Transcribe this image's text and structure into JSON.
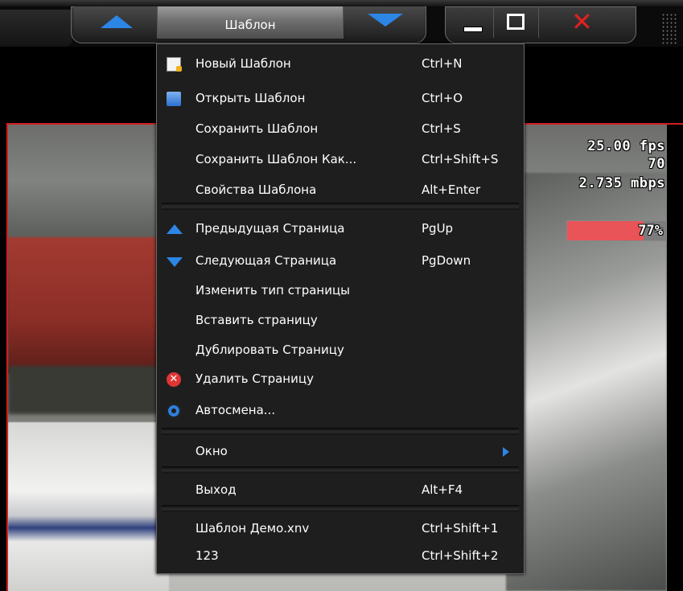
{
  "toolbar": {
    "template_label": "Шаблон",
    "prev_icon": "triangle-up-icon",
    "next_icon": "triangle-down-icon",
    "close_glyph": "✕"
  },
  "stats": {
    "fps": "25.00 fps",
    "count": "70",
    "bitrate": "2.735 mbps",
    "progress_label": "77%",
    "progress_value": 0.77
  },
  "menu": {
    "items": [
      {
        "label": "Новый Шаблон",
        "shortcut": "Ctrl+N",
        "icon": "new-document-icon"
      },
      {
        "label": "Открыть Шаблон",
        "shortcut": "Ctrl+O",
        "icon": "open-folder-icon"
      },
      {
        "label": "Сохранить Шаблон",
        "shortcut": "Ctrl+S"
      },
      {
        "label": "Сохранить Шаблон Как...",
        "shortcut": "Ctrl+Shift+S"
      },
      {
        "label": "Свойства Шаблона",
        "shortcut": "Alt+Enter"
      },
      {
        "label": "Предыдущая Страница",
        "shortcut": "PgUp",
        "icon": "triangle-up-icon"
      },
      {
        "label": "Следующая Страница",
        "shortcut": "PgDown",
        "icon": "triangle-down-icon"
      },
      {
        "label": "Изменить тип страницы",
        "shortcut": ""
      },
      {
        "label": "Вставить страницу",
        "shortcut": ""
      },
      {
        "label": "Дублировать Страницу",
        "shortcut": ""
      },
      {
        "label": "Удалить Страницу",
        "shortcut": "",
        "icon": "delete-icon"
      },
      {
        "label": "Автосмена...",
        "shortcut": "",
        "icon": "gear-icon"
      },
      {
        "label": "Окно",
        "shortcut": "",
        "submenu": true
      },
      {
        "label": "Выход",
        "shortcut": "Alt+F4"
      },
      {
        "label": "Шаблон Демо.xnv",
        "shortcut": "Ctrl+Shift+1"
      },
      {
        "label": "123",
        "shortcut": "Ctrl+Shift+2"
      }
    ]
  },
  "colors": {
    "accent_blue": "#2c86e6",
    "close_red": "#e02020",
    "progress_red": "#e85457",
    "frame_red": "#d21f1f",
    "menu_bg": "#1e1e1e"
  }
}
